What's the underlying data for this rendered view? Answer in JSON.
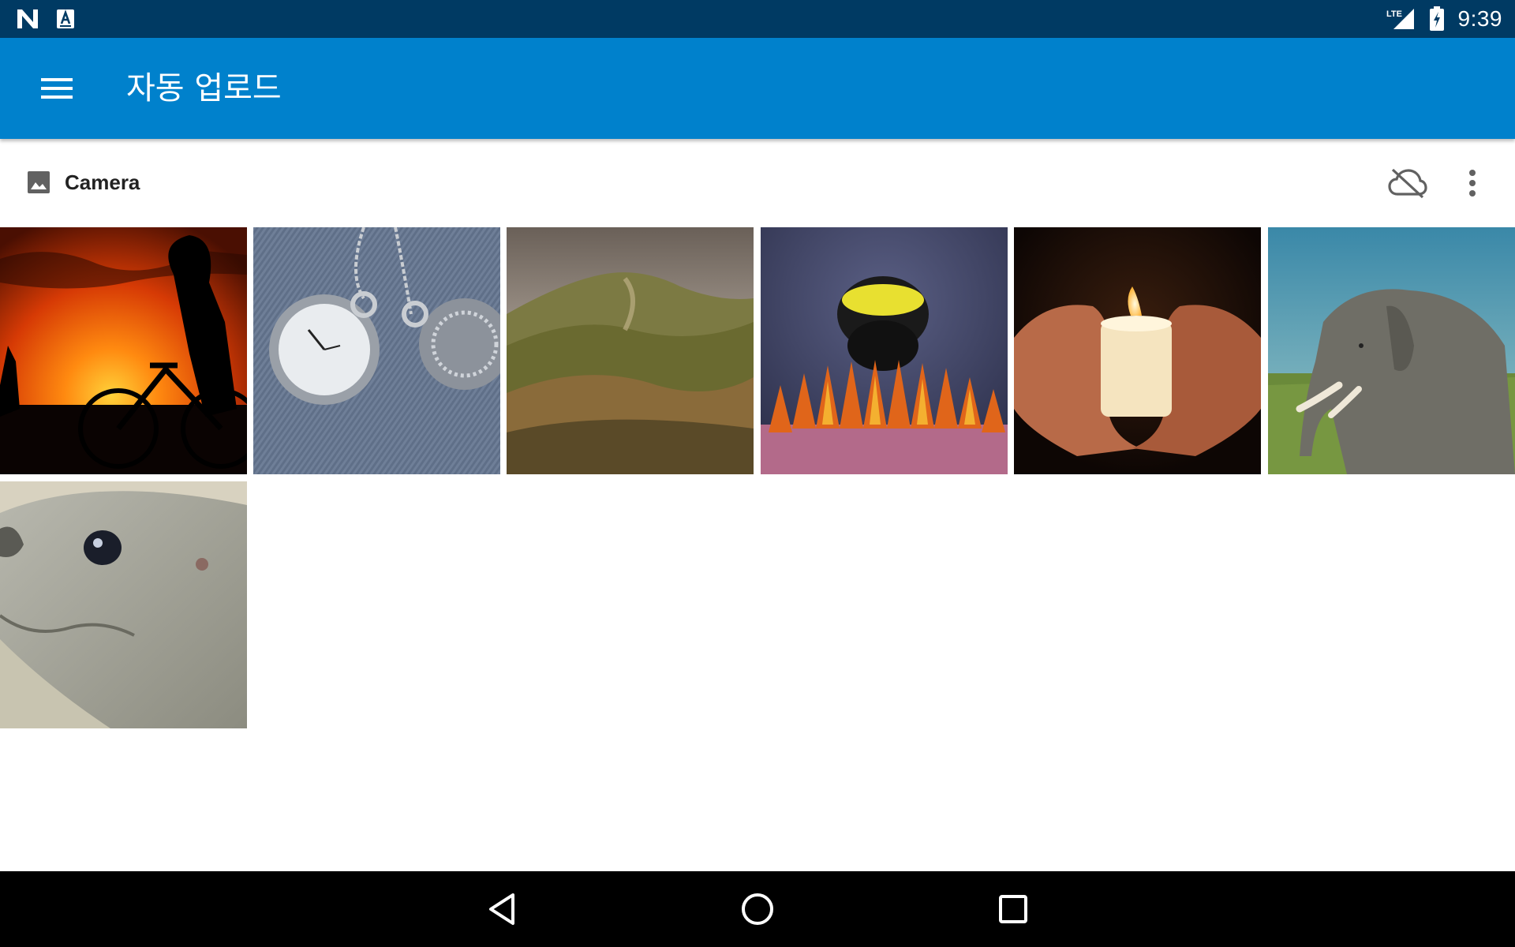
{
  "status_bar": {
    "time": "9:39",
    "network": "LTE",
    "left_icons": [
      "n-logo-icon",
      "a-text-icon"
    ],
    "right_icons": [
      "lte-signal-icon",
      "battery-charging-icon"
    ]
  },
  "app_bar": {
    "title": "자동 업로드",
    "menu_icon": "hamburger-menu-icon",
    "color": "#0081cc"
  },
  "folder": {
    "name": "Camera",
    "icon": "image-icon",
    "actions": [
      "cloud-off-icon",
      "more-vert-icon"
    ]
  },
  "photos": [
    {
      "subject": "sunset-bicycle"
    },
    {
      "subject": "pocket-watches"
    },
    {
      "subject": "hills-landscape"
    },
    {
      "subject": "bumblebee-flower"
    },
    {
      "subject": "candle-hands"
    },
    {
      "subject": "elephant"
    },
    {
      "subject": "seal"
    }
  ],
  "nav_bar": {
    "buttons": [
      "back-icon",
      "home-icon",
      "recents-icon"
    ]
  },
  "colors": {
    "status_bar": "#003a63",
    "app_bar": "#0081cc",
    "nav_bar": "#000000"
  }
}
